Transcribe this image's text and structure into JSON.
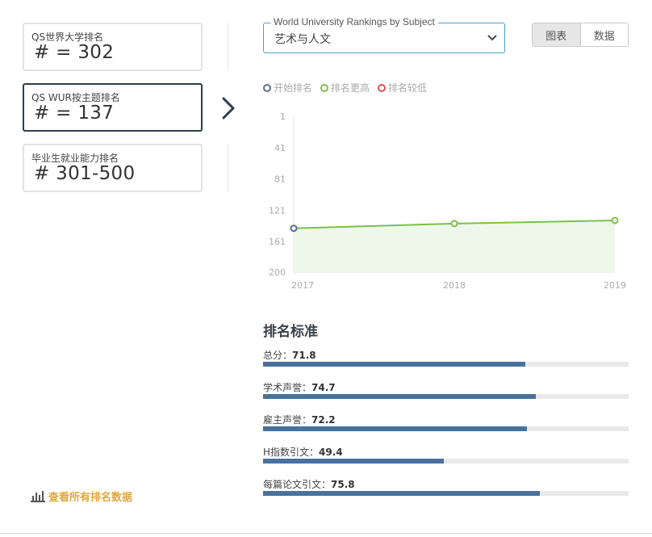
{
  "ranks": [
    {
      "label": "QS世界大学排名",
      "value": "# = 302"
    },
    {
      "label": "QS WUR按主题排名",
      "value": "# = 137"
    },
    {
      "label": "毕业生就业能力排名",
      "value": "# 301-500"
    }
  ],
  "subject_select": {
    "legend": "World University Rankings by Subject",
    "value": "艺术与人文"
  },
  "view_toggle": {
    "chart_label": "图表",
    "data_label": "数据"
  },
  "legend": [
    {
      "label": "开始排名",
      "color": "#5b6a8f"
    },
    {
      "label": "排名更高",
      "color": "#7cc04b"
    },
    {
      "label": "排名较低",
      "color": "#d9534f"
    }
  ],
  "chart_data": {
    "type": "area",
    "x": [
      "2017",
      "2018",
      "2019"
    ],
    "y": [
      144,
      138,
      134
    ],
    "y_ticks": [
      1,
      41,
      81,
      121,
      161,
      200
    ],
    "ylim": [
      1,
      200
    ],
    "y_reversed": true,
    "point_colors": [
      "#5b6a8f",
      "#7cc04b",
      "#7cc04b"
    ],
    "line_color": "#7cc04b",
    "fill_color": "#eef8ea"
  },
  "criteria": {
    "title": "排名标准",
    "items": [
      {
        "label": "总分：",
        "value": "71.8",
        "score": 71.8
      },
      {
        "label": "学术声誉：",
        "value": "74.7",
        "score": 74.7
      },
      {
        "label": "雇主声誉：",
        "value": "72.2",
        "score": 72.2
      },
      {
        "label": "H指数引文：",
        "value": "49.4",
        "score": 49.4
      },
      {
        "label": "每篇论文引文：",
        "value": "75.8",
        "score": 75.8
      }
    ],
    "bar_color": "#48729b"
  },
  "view_all": {
    "label": "查看所有排名数据",
    "icon": "bar-chart-icon"
  }
}
